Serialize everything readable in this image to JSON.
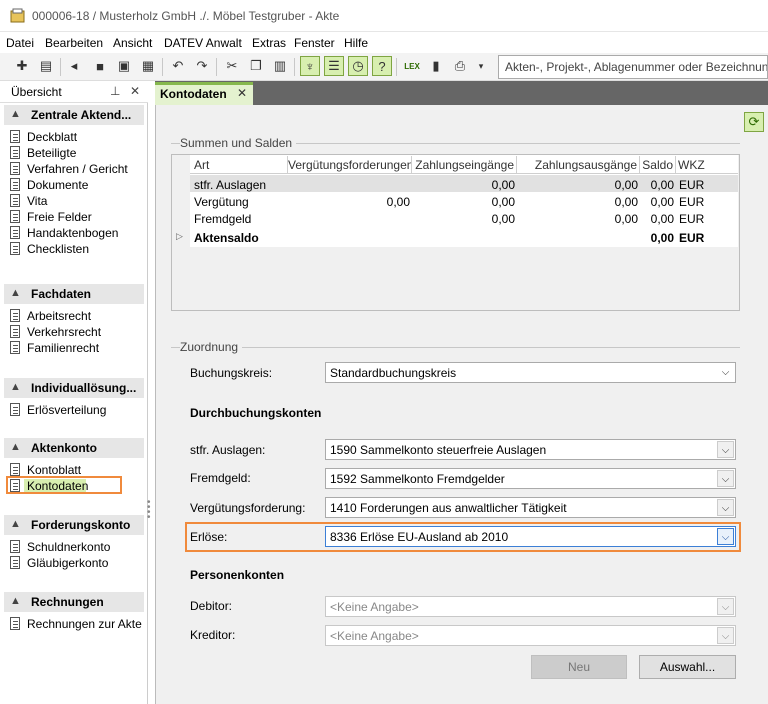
{
  "window": {
    "title": "000006-18 / Musterholz GmbH ./. Möbel Testgruber - Akte"
  },
  "menu": [
    "Datei",
    "Bearbeiten",
    "Ansicht",
    "DATEV Anwalt",
    "Extras",
    "Fenster",
    "Hilfe"
  ],
  "toolbar": {
    "search_placeholder": "Akten-, Projekt-, Ablagenummer oder Bezeichnung"
  },
  "sidebar": {
    "title": "Übersicht",
    "groups": [
      {
        "label": "Zentrale Aktend...",
        "items": [
          "Deckblatt",
          "Beteiligte",
          "Verfahren / Gericht",
          "Dokumente",
          "Vita",
          "Freie Felder",
          "Handaktenbogen",
          "Checklisten"
        ]
      },
      {
        "label": "Fachdaten",
        "items": [
          "Arbeitsrecht",
          "Verkehrsrecht",
          "Familienrecht"
        ]
      },
      {
        "label": "Individuallösung...",
        "items": [
          "Erlösverteilung"
        ]
      },
      {
        "label": "Aktenkonto",
        "items": [
          "Kontoblatt",
          "Kontodaten"
        ]
      },
      {
        "label": "Forderungskonto",
        "items": [
          "Schuldnerkonto",
          "Gläubigerkonto"
        ]
      },
      {
        "label": "Rechnungen",
        "items": [
          "Rechnungen zur Akte"
        ]
      }
    ],
    "selected": "Kontodaten"
  },
  "tab": {
    "label": "Kontodaten",
    "close": "✕"
  },
  "summen": {
    "title": "Summen und Salden",
    "columns": [
      "Art",
      "Vergütungsforderungen",
      "Zahlungseingänge",
      "Zahlungsausgänge",
      "Saldo",
      "WKZ"
    ],
    "rows": [
      [
        "stfr. Auslagen",
        "",
        "0,00",
        "0,00",
        "0,00",
        "EUR"
      ],
      [
        "Vergütung",
        "0,00",
        "0,00",
        "0,00",
        "0,00",
        "EUR"
      ],
      [
        "Fremdgeld",
        "",
        "0,00",
        "0,00",
        "0,00",
        "EUR"
      ]
    ],
    "total": [
      "Aktensaldo",
      "",
      "",
      "",
      "0,00",
      "EUR"
    ]
  },
  "zuordnung": {
    "title": "Zuordnung",
    "buchungskreis_label": "Buchungskreis:",
    "buchungskreis_value": "Standardbuchungskreis",
    "durchbuchung_heading": "Durchbuchungskonten",
    "stfr_label": "stfr. Auslagen:",
    "stfr_value": "1590  Sammelkonto steuerfreie Auslagen",
    "fremdgeld_label": "Fremdgeld:",
    "fremdgeld_value": "1592  Sammelkonto Fremdgelder",
    "verg_label": "Vergütungsforderung:",
    "verg_value": "1410  Forderungen aus anwaltlicher Tätigkeit",
    "erloese_label": "Erlöse:",
    "erloese_value": "8336  Erlöse EU-Ausland ab 2010",
    "personen_heading": "Personenkonten",
    "debitor_label": "Debitor:",
    "debitor_value": "<Keine Angabe>",
    "kreditor_label": "Kreditor:",
    "kreditor_value": "<Keine Angabe>"
  },
  "buttons": {
    "neu": "Neu",
    "auswahl": "Auswahl..."
  }
}
